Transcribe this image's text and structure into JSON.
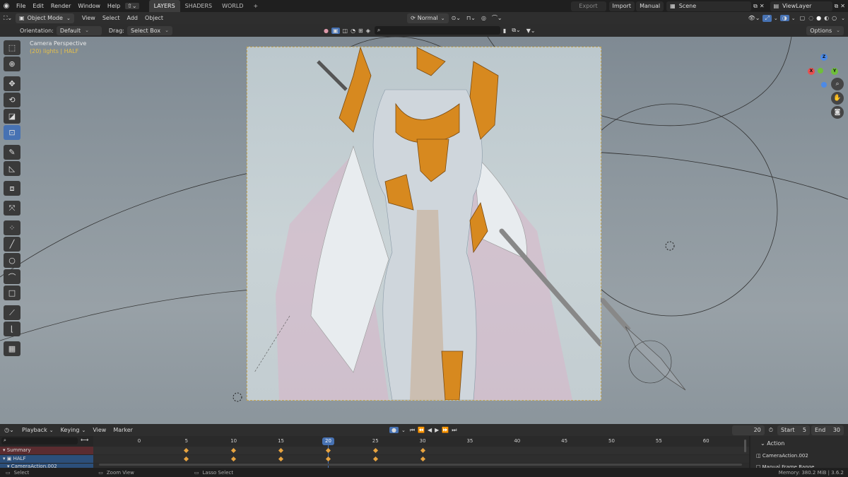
{
  "topbar": {
    "menus": [
      "File",
      "Edit",
      "Render",
      "Window",
      "Help"
    ],
    "workspaces": [
      "LAYERS",
      "SHADERS",
      "WORLD"
    ],
    "active_workspace": "LAYERS",
    "add_tab": "+",
    "export_label": "Export",
    "import_label": "Import",
    "manual_label": "Manual",
    "scene_label": "Scene",
    "viewlayer_label": "ViewLayer"
  },
  "header": {
    "mode": "Object Mode",
    "menus": [
      "View",
      "Select",
      "Add",
      "Object"
    ],
    "transform": "Normal",
    "options_label": "Options"
  },
  "toolheader": {
    "orientation_label": "Orientation:",
    "orientation_value": "Default",
    "drag_label": "Drag:",
    "drag_value": "Select Box"
  },
  "viewport": {
    "overlay_title": "Camera Perspective",
    "overlay_sub": "(20) lights | HALF",
    "gizmo": {
      "x": "X",
      "y": "Y",
      "z": "Z"
    }
  },
  "toolbar_icons": [
    "select-box-icon",
    "cursor-icon",
    "move-icon",
    "rotate-icon",
    "scale-icon",
    "transform-icon",
    "annotate-icon",
    "measure-icon",
    "add-cube-icon",
    "extrude-icon",
    "add-point-icon",
    "add-line-icon",
    "add-circle-icon",
    "add-curve-icon",
    "add-rect-icon",
    "knife-icon",
    "polyline-icon",
    "grid-icon"
  ],
  "timeline": {
    "menus": [
      "Playback",
      "Keying",
      "View",
      "Marker"
    ],
    "current_frame": "20",
    "start_label": "Start",
    "start_value": "5",
    "end_label": "End",
    "end_value": "30",
    "ticks": [
      "0",
      "5",
      "10",
      "15",
      "20",
      "25",
      "30",
      "35",
      "40",
      "45",
      "50",
      "55",
      "60"
    ],
    "channels": [
      "Summary",
      "HALF",
      "CameraAction.002"
    ],
    "side_title": "Action",
    "side_action": "CameraAction.002",
    "side_manual": "Manual Frame Range"
  },
  "status": {
    "select": "Select",
    "zoom": "Zoom View",
    "lasso": "Lasso Select",
    "memory": "Memory: 380.2 MiB | 3.6.2"
  },
  "colors": {
    "accent": "#4772b3",
    "keyframe": "#e8a440",
    "camera_frame": "#c8a854",
    "current_frame": "#4772b3"
  }
}
